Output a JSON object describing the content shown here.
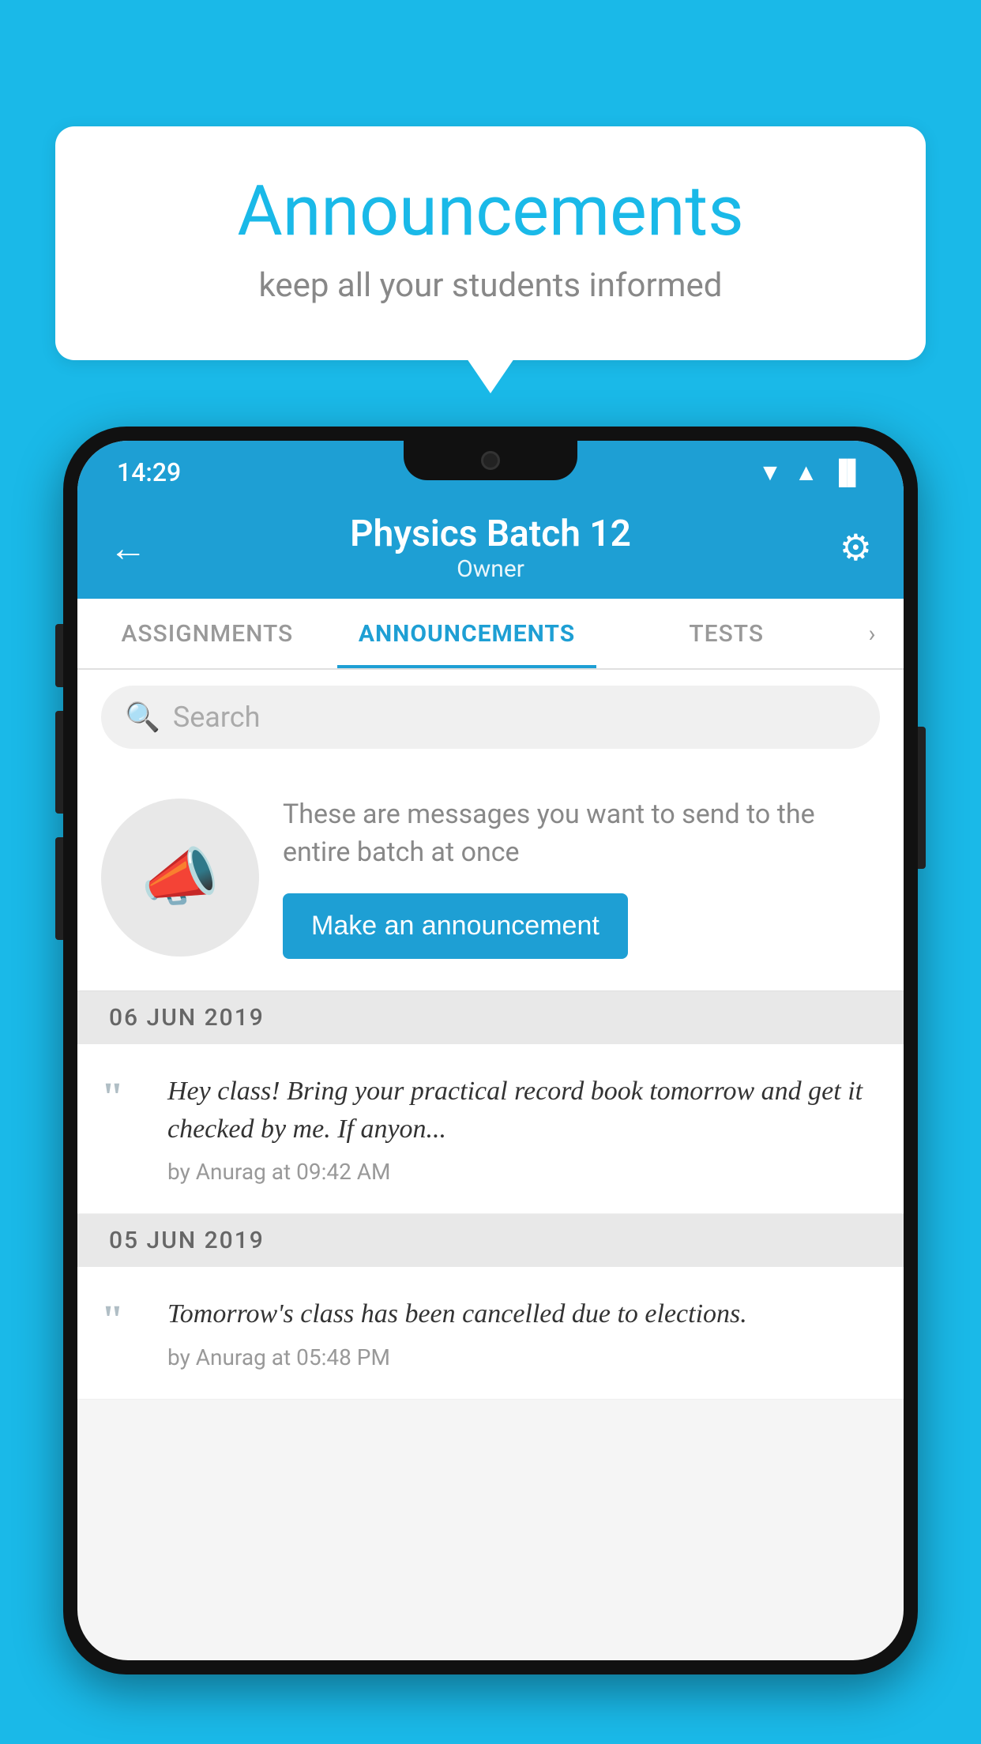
{
  "page": {
    "background_color": "#1ab9e8"
  },
  "speech_bubble": {
    "title": "Announcements",
    "subtitle": "keep all your students informed"
  },
  "status_bar": {
    "time": "14:29",
    "wifi": "▲",
    "signal": "▲",
    "battery": "▐"
  },
  "app_header": {
    "title": "Physics Batch 12",
    "subtitle": "Owner",
    "back_label": "←",
    "gear_label": "⚙"
  },
  "tabs": [
    {
      "label": "ASSIGNMENTS",
      "active": false
    },
    {
      "label": "ANNOUNCEMENTS",
      "active": true
    },
    {
      "label": "TESTS",
      "active": false
    }
  ],
  "tabs_more": "›",
  "search": {
    "placeholder": "Search"
  },
  "announcement_prompt": {
    "description": "These are messages you want to send to the entire batch at once",
    "button_label": "Make an announcement"
  },
  "date_sections": [
    {
      "date": "06  JUN  2019",
      "items": [
        {
          "text": "Hey class! Bring your practical record book tomorrow and get it checked by me. If anyon...",
          "meta": "by Anurag at 09:42 AM"
        }
      ]
    },
    {
      "date": "05  JUN  2019",
      "items": [
        {
          "text": "Tomorrow's class has been cancelled due to elections.",
          "meta": "by Anurag at 05:48 PM"
        }
      ]
    }
  ]
}
